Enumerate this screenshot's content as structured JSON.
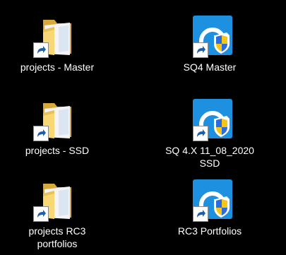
{
  "desktop": {
    "background_color": "#000000",
    "icons": [
      {
        "label": "projects - Master",
        "type": "folder-shortcut",
        "icon": "folder-icon"
      },
      {
        "label": "SQ4 Master",
        "type": "app-shortcut",
        "icon": "app-shield-icon"
      },
      {
        "label": "projects - SSD",
        "type": "folder-shortcut",
        "icon": "folder-icon"
      },
      {
        "label": "SQ 4.X 11_08_2020 SSD",
        "type": "app-shortcut",
        "icon": "app-shield-icon"
      },
      {
        "label": "projects RC3 portfolios",
        "type": "folder-shortcut",
        "icon": "folder-icon"
      },
      {
        "label": "RC3 Portfolios",
        "type": "app-shortcut",
        "icon": "app-shield-icon"
      }
    ]
  },
  "colors": {
    "folder_back": "#E0B94A",
    "folder_front": "#F8D775",
    "app_bg": "#1E90E0",
    "shield_yellow": "#F5C518",
    "shield_blue": "#2A6BE0"
  }
}
